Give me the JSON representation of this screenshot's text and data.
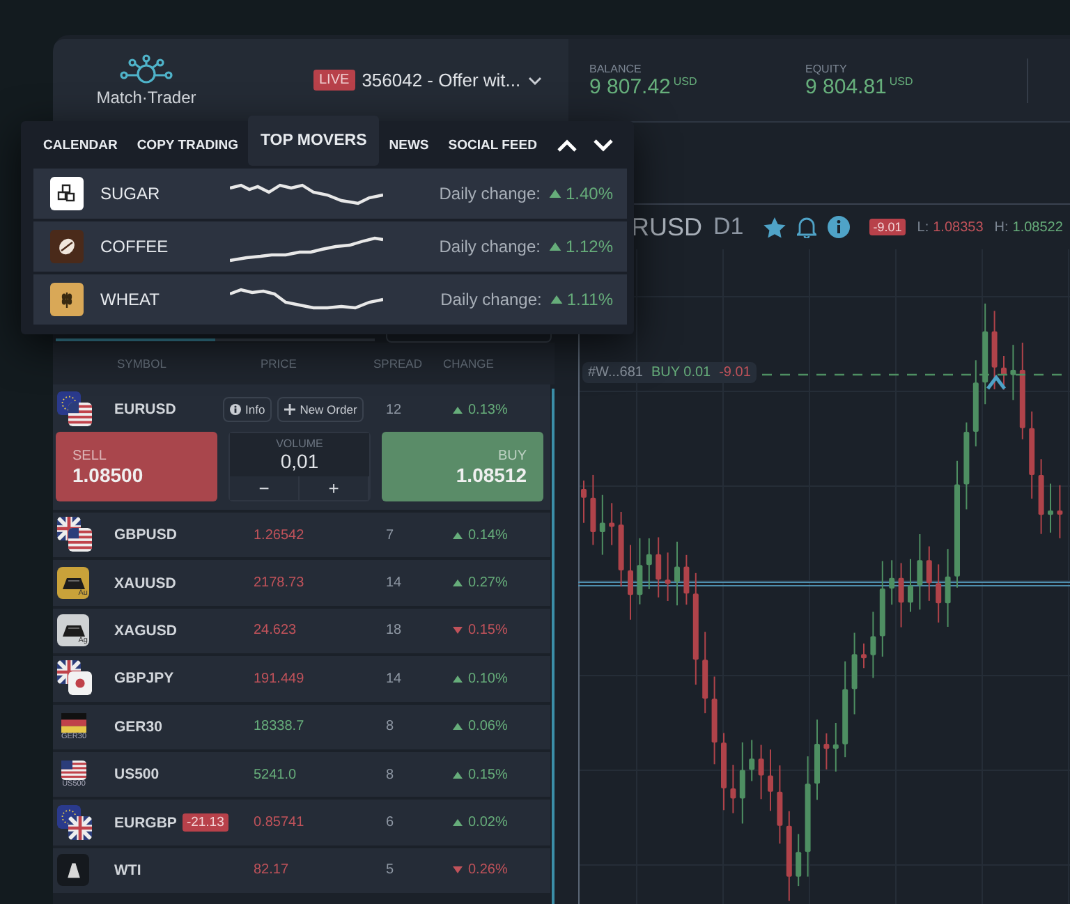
{
  "header": {
    "logo": "Match·Trader",
    "account": {
      "badge": "LIVE",
      "name": "356042 - Offer wit..."
    },
    "stats": [
      {
        "label": "BALANCE",
        "value": "9 807.42",
        "currency": "USD"
      },
      {
        "label": "EQUITY",
        "value": "9 804.81",
        "currency": "USD"
      }
    ]
  },
  "panel_tabs": [
    {
      "label": "CALENDAR",
      "selected": false
    },
    {
      "label": "COPY TRADING",
      "selected": false
    },
    {
      "label": "TOP MOVERS",
      "selected": true
    },
    {
      "label": "NEWS",
      "selected": false
    },
    {
      "label": "SOCIAL FEED",
      "selected": false
    }
  ],
  "top_movers": [
    {
      "name": "SUGAR",
      "kind": "sugar",
      "change_label": "Daily change:",
      "change": "1.40%",
      "rising": true
    },
    {
      "name": "COFFEE",
      "kind": "coffee",
      "change_label": "Daily change:",
      "change": "1.12%",
      "rising": true
    },
    {
      "name": "WHEAT",
      "kind": "wheat",
      "change_label": "Daily change:",
      "change": "1.11%",
      "rising": true
    }
  ],
  "market_watch": {
    "columns": [
      "SYMBOL",
      "PRICE",
      "SPREAD",
      "CHANGE"
    ],
    "expanded": {
      "symbol": "EURUSD",
      "kind": "eu-us",
      "info": "Info",
      "new_order": "New Order",
      "spread": "12",
      "change": "0.13%",
      "rising": true,
      "sell": {
        "label": "SELL",
        "price": "1.08500"
      },
      "volume": {
        "label": "VOLUME",
        "value": "0,01",
        "minus": "−",
        "plus": "+"
      },
      "buy": {
        "label": "BUY",
        "price": "1.08512"
      }
    },
    "rows": [
      {
        "symbol": "GBPUSD",
        "kind": "gb-us",
        "price": "1.26542",
        "price_rising": false,
        "spread": "7",
        "change": "0.14%",
        "rising": true
      },
      {
        "symbol": "XAUUSD",
        "kind": "gold",
        "icon_label": "Au",
        "price": "2178.73",
        "price_rising": false,
        "spread": "14",
        "change": "0.27%",
        "rising": true
      },
      {
        "symbol": "XAGUSD",
        "kind": "silver",
        "icon_label": "Ag",
        "price": "24.623",
        "price_rising": false,
        "spread": "18",
        "change": "0.15%",
        "rising": false
      },
      {
        "symbol": "GBPJPY",
        "kind": "gb-jp",
        "price": "191.449",
        "price_rising": false,
        "spread": "14",
        "change": "0.10%",
        "rising": true
      },
      {
        "symbol": "GER30",
        "kind": "de-index",
        "icon_label": "GER30",
        "price": "18338.7",
        "price_rising": true,
        "spread": "8",
        "change": "0.06%",
        "rising": true
      },
      {
        "symbol": "US500",
        "kind": "us-index",
        "icon_label": "US500",
        "price": "5241.0",
        "price_rising": true,
        "spread": "8",
        "change": "0.15%",
        "rising": true
      },
      {
        "symbol": "EURGBP",
        "kind": "eu-gb",
        "badge": "-21.13",
        "price": "0.85741",
        "price_rising": false,
        "spread": "6",
        "change": "0.02%",
        "rising": true
      },
      {
        "symbol": "WTI",
        "kind": "oil",
        "price": "82.17",
        "price_rising": false,
        "spread": "5",
        "change": "0.26%",
        "rising": false
      }
    ]
  },
  "chart": {
    "symbol": "RUSD",
    "timeframe": "D1",
    "pl_badge": "-9.01",
    "low_label": "L:",
    "low": "1.08353",
    "high_label": "H:",
    "high": "1.08522",
    "trade": {
      "id": "#W...681",
      "side": "BUY 0.01",
      "pl": "-9.01"
    }
  }
}
